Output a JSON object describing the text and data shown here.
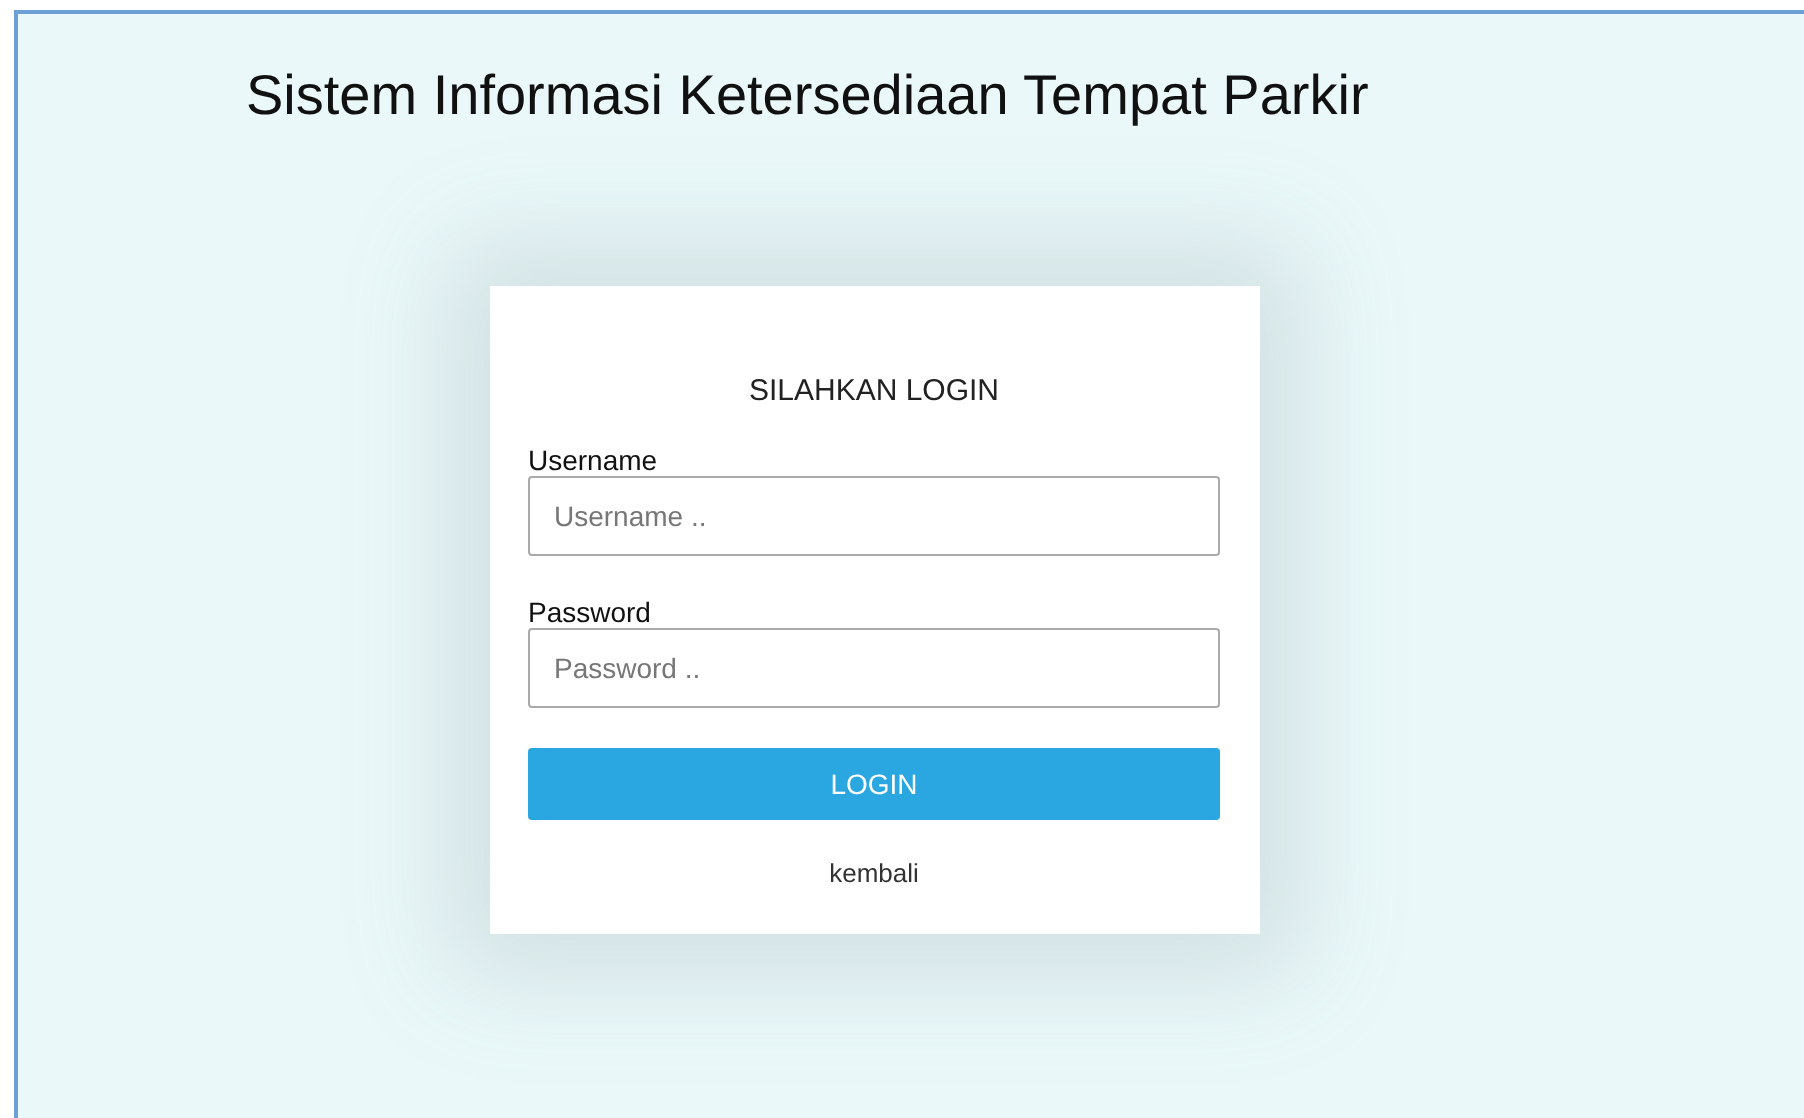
{
  "page": {
    "title": "Sistem Informasi Ketersediaan Tempat Parkir"
  },
  "login_card": {
    "heading": "SILAHKAN LOGIN",
    "fields": [
      {
        "label": "Username",
        "placeholder": "Username .."
      },
      {
        "label": "Password",
        "placeholder": "Password .."
      }
    ],
    "button": "LOGIN",
    "back_link": "kembali"
  }
}
